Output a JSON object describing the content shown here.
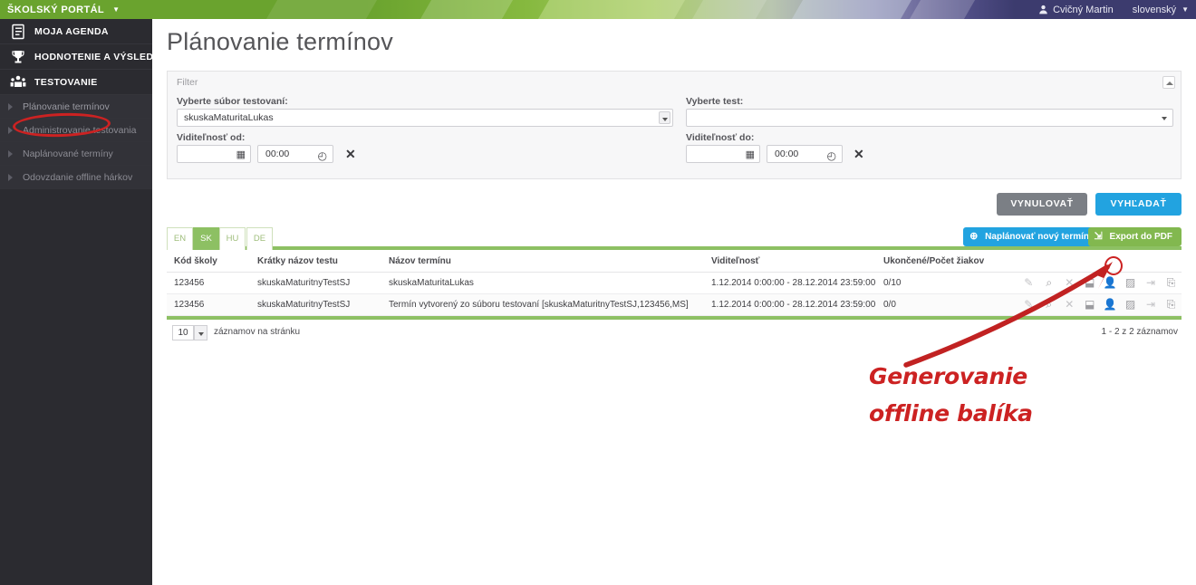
{
  "topbar": {
    "brand": "ŠKOLSKÝ PORTÁL",
    "brand_caret": "▼",
    "user_icon": "user-icon",
    "user_name": "Cvičný Martin",
    "language": "slovenský",
    "lang_caret": "▼"
  },
  "sidebar": {
    "main_items": [
      {
        "label": "MOJA AGENDA",
        "icon": "clipboard-icon"
      },
      {
        "label": "HODNOTENIE A VÝSLEDKY",
        "icon": "trophy-icon"
      },
      {
        "label": "TESTOVANIE",
        "icon": "people-icon"
      }
    ],
    "sub_items": [
      {
        "label": "Plánovanie termínov",
        "selected": true
      },
      {
        "label": "Administrovanie testovania",
        "selected": false
      },
      {
        "label": "Naplánované termíny",
        "selected": false
      },
      {
        "label": "Odovzdanie offline hárkov",
        "selected": false
      }
    ]
  },
  "page": {
    "title": "Plánovanie termínov"
  },
  "filter": {
    "legend": "Filter",
    "collapse_icon": "chevron-up-icon",
    "file_label": "Vyberte súbor testovaní:",
    "file_value": "skuskaMaturitaLukas",
    "test_label": "Vyberte test:",
    "test_value": "",
    "visible_from_label": "Viditeľnosť od:",
    "visible_to_label": "Viditeľnosť do:",
    "date_from_value": "",
    "time_from_value": "00:00",
    "date_to_value": "",
    "time_to_value": "00:00",
    "calendar_icon": "calendar-icon",
    "clock_icon": "clock-icon",
    "clear_icon": "clear-x-icon"
  },
  "actions": {
    "reset_label": "VYNULOVAŤ",
    "search_label": "VYHĽADAŤ",
    "reset_color": "#7b7f85",
    "search_color": "#22a3e0",
    "new_term_label": "Naplánovať nový termín",
    "new_term_icon": "plus-circle-icon",
    "new_term_color": "#22a3e0",
    "export_pdf_label": "Export do PDF",
    "export_pdf_icon": "pdf-export-icon",
    "export_pdf_color": "#82b84f"
  },
  "tabs": [
    {
      "label": "EN",
      "active": false
    },
    {
      "label": "SK",
      "active": true
    },
    {
      "label": "HU",
      "active": false
    },
    {
      "label": "DE",
      "active": false
    }
  ],
  "table": {
    "columns": [
      "Kód školy",
      "Krátky názov testu",
      "Názov termínu",
      "Viditeľnosť",
      "Ukončené/Počet žiakov"
    ],
    "rows": [
      {
        "school_code": "123456",
        "test_short_name": "skuskaMaturitnyTestSJ",
        "term_name": "skuskaMaturitaLukas",
        "visibility": "1.12.2014 0:00:00 - 28.12.2014 23:59:00",
        "finished_count": "0/10",
        "icons": [
          "pencil-icon",
          "magnifier-icon",
          "close-x-icon",
          "download-icon",
          "person-icon",
          "document-edit-icon",
          "import-icon",
          "export-icon"
        ]
      },
      {
        "school_code": "123456",
        "test_short_name": "skuskaMaturitnyTestSJ",
        "term_name": "Termín vytvorený zo súboru testovaní [skuskaMaturitnyTestSJ,123456,MS]",
        "visibility": "1.12.2014 0:00:00 - 28.12.2014 23:59:00",
        "finished_count": "0/0",
        "icons": [
          "pencil-icon",
          "magnifier-icon",
          "close-x-icon",
          "download-icon",
          "person-icon",
          "document-edit-icon",
          "import-icon",
          "export-icon"
        ]
      }
    ]
  },
  "pager": {
    "page_size": "10",
    "page_size_label": "záznamov na stránku",
    "record_count": "1 - 2 z 2 záznamov"
  },
  "annotation": {
    "line1": "Generovanie",
    "line2": "offline balíka",
    "color": "#cc2222"
  },
  "icon_glyphs": {
    "pencil": "✎",
    "magnifier": "🔍",
    "close_x": "✕",
    "download": "⬇",
    "person": "👤",
    "document": "▨",
    "import": "⇥",
    "export": "⇨",
    "calendar": "▦",
    "clock": "◴",
    "plus": "⊕"
  }
}
